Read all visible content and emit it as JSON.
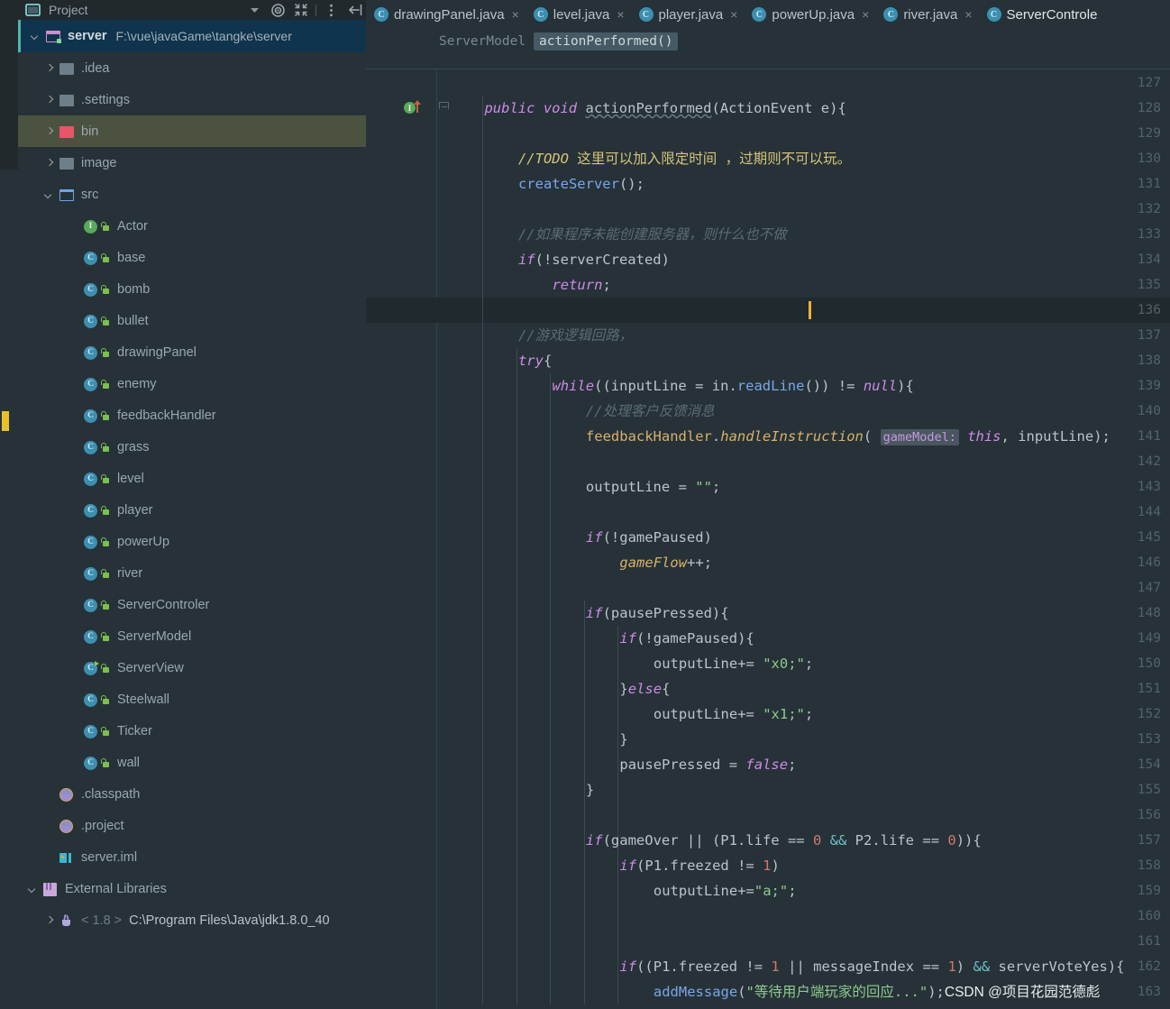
{
  "panel": {
    "title": "Project",
    "icons": {
      "title_icon": "project-folder-icon",
      "dropdown": "chevron-down-icon",
      "locate": "target-locate-icon",
      "collapse_all": "collapse-all-icon",
      "options": "more-vertical-icon",
      "hide": "hide-panel-icon"
    }
  },
  "tree": [
    {
      "label": "server",
      "path": "F:\\vue\\javaGame\\tangke\\server",
      "icon": "module-folder-icon",
      "arrow": "down",
      "depth": 0,
      "state": "root"
    },
    {
      "label": ".idea",
      "path": "",
      "icon": "folder-icon",
      "arrow": "right",
      "depth": 1,
      "state": ""
    },
    {
      "label": ".settings",
      "path": "",
      "icon": "folder-icon",
      "arrow": "right",
      "depth": 1,
      "state": ""
    },
    {
      "label": "bin",
      "path": "",
      "icon": "folder-excluded-icon",
      "arrow": "right",
      "depth": 1,
      "state": "selected"
    },
    {
      "label": "image",
      "path": "",
      "icon": "folder-icon",
      "arrow": "right",
      "depth": 1,
      "state": ""
    },
    {
      "label": "src",
      "path": "",
      "icon": "source-folder-icon",
      "arrow": "down",
      "depth": 1,
      "state": ""
    },
    {
      "label": "Actor",
      "path": "",
      "icon": "interface-icon",
      "arrow": "",
      "depth": 2,
      "state": ""
    },
    {
      "label": "base",
      "path": "",
      "icon": "class-icon",
      "arrow": "",
      "depth": 2,
      "state": ""
    },
    {
      "label": "bomb",
      "path": "",
      "icon": "class-icon",
      "arrow": "",
      "depth": 2,
      "state": ""
    },
    {
      "label": "bullet",
      "path": "",
      "icon": "class-icon",
      "arrow": "",
      "depth": 2,
      "state": ""
    },
    {
      "label": "drawingPanel",
      "path": "",
      "icon": "class-icon",
      "arrow": "",
      "depth": 2,
      "state": ""
    },
    {
      "label": "enemy",
      "path": "",
      "icon": "class-icon",
      "arrow": "",
      "depth": 2,
      "state": ""
    },
    {
      "label": "feedbackHandler",
      "path": "",
      "icon": "class-icon",
      "arrow": "",
      "depth": 2,
      "state": ""
    },
    {
      "label": "grass",
      "path": "",
      "icon": "class-icon",
      "arrow": "",
      "depth": 2,
      "state": ""
    },
    {
      "label": "level",
      "path": "",
      "icon": "class-icon",
      "arrow": "",
      "depth": 2,
      "state": ""
    },
    {
      "label": "player",
      "path": "",
      "icon": "class-icon",
      "arrow": "",
      "depth": 2,
      "state": ""
    },
    {
      "label": "powerUp",
      "path": "",
      "icon": "class-icon",
      "arrow": "",
      "depth": 2,
      "state": ""
    },
    {
      "label": "river",
      "path": "",
      "icon": "class-icon",
      "arrow": "",
      "depth": 2,
      "state": ""
    },
    {
      "label": "ServerControler",
      "path": "",
      "icon": "class-icon",
      "arrow": "",
      "depth": 2,
      "state": ""
    },
    {
      "label": "ServerModel",
      "path": "",
      "icon": "class-icon",
      "arrow": "",
      "depth": 2,
      "state": ""
    },
    {
      "label": "ServerView",
      "path": "",
      "icon": "runnable-class-icon",
      "arrow": "",
      "depth": 2,
      "state": ""
    },
    {
      "label": "Steelwall",
      "path": "",
      "icon": "class-icon",
      "arrow": "",
      "depth": 2,
      "state": ""
    },
    {
      "label": "Ticker",
      "path": "",
      "icon": "class-icon",
      "arrow": "",
      "depth": 2,
      "state": ""
    },
    {
      "label": "wall",
      "path": "",
      "icon": "class-icon",
      "arrow": "",
      "depth": 2,
      "state": ""
    },
    {
      "label": ".classpath",
      "path": "",
      "icon": "xml-file-icon",
      "arrow": "",
      "depth": 1,
      "state": ""
    },
    {
      "label": ".project",
      "path": "",
      "icon": "xml-file-icon",
      "arrow": "",
      "depth": 1,
      "state": ""
    },
    {
      "label": "server.iml",
      "path": "",
      "icon": "iml-file-icon",
      "arrow": "",
      "depth": 1,
      "state": ""
    },
    {
      "label": "External Libraries",
      "path": "",
      "icon": "library-icon",
      "arrow": "down",
      "depth": 0,
      "state": ""
    },
    {
      "label": "< 1.8 >",
      "path": "C:\\Program Files\\Java\\jdk1.8.0_40",
      "icon": "jdk-icon",
      "arrow": "right",
      "depth": 1,
      "state": "jdk"
    }
  ],
  "tabs": [
    {
      "label": "drawingPanel.java",
      "closable": true,
      "active": false
    },
    {
      "label": "level.java",
      "closable": true,
      "active": false
    },
    {
      "label": "player.java",
      "closable": true,
      "active": false
    },
    {
      "label": "powerUp.java",
      "closable": true,
      "active": false
    },
    {
      "label": "river.java",
      "closable": true,
      "active": false
    },
    {
      "label": "ServerControle",
      "closable": false,
      "active": true
    }
  ],
  "tab_close_glyph": "×",
  "breadcrumb": {
    "class": "ServerModel",
    "method": "actionPerformed()"
  },
  "editor": {
    "first_line": 127,
    "last_line": 163,
    "current_line": 136,
    "gutter_glyphs": {
      "line": 128,
      "impl": "I",
      "override_arrow": "override-up-arrow-icon",
      "fold": "fold-region-icon"
    },
    "watermark": "CSDN @项目花园范德彪",
    "lines": [
      {
        "n": 127,
        "code": ""
      },
      {
        "n": 128,
        "code": "    public void actionPerformed(ActionEvent e){"
      },
      {
        "n": 129,
        "code": ""
      },
      {
        "n": 130,
        "code": "        //TODO 这里可以加入限定时间 ，过期则不可以玩。"
      },
      {
        "n": 131,
        "code": "        createServer();"
      },
      {
        "n": 132,
        "code": ""
      },
      {
        "n": 133,
        "code": "        //如果程序未能创建服务器，则什么也不做"
      },
      {
        "n": 134,
        "code": "        if(!serverCreated)"
      },
      {
        "n": 135,
        "code": "            return;"
      },
      {
        "n": 136,
        "code": ""
      },
      {
        "n": 137,
        "code": "        //游戏逻辑回路，"
      },
      {
        "n": 138,
        "code": "        try{"
      },
      {
        "n": 139,
        "code": "            while((inputLine = in.readLine()) != null){"
      },
      {
        "n": 140,
        "code": "                //处理客户反馈消息"
      },
      {
        "n": 141,
        "code": "                feedbackHandler.handleInstruction( gameModel: this, inputLine);"
      },
      {
        "n": 142,
        "code": ""
      },
      {
        "n": 143,
        "code": "                outputLine = \"\";"
      },
      {
        "n": 144,
        "code": ""
      },
      {
        "n": 145,
        "code": "                if(!gamePaused)"
      },
      {
        "n": 146,
        "code": "                    gameFlow++;"
      },
      {
        "n": 147,
        "code": ""
      },
      {
        "n": 148,
        "code": "                if(pausePressed){"
      },
      {
        "n": 149,
        "code": "                    if(!gamePaused){"
      },
      {
        "n": 150,
        "code": "                        outputLine+= \"x0;\";"
      },
      {
        "n": 151,
        "code": "                    }else{"
      },
      {
        "n": 152,
        "code": "                        outputLine+= \"x1;\";"
      },
      {
        "n": 153,
        "code": "                    }"
      },
      {
        "n": 154,
        "code": "                    pausePressed = false;"
      },
      {
        "n": 155,
        "code": "                }"
      },
      {
        "n": 156,
        "code": ""
      },
      {
        "n": 157,
        "code": "                if(gameOver || (P1.life == 0 && P2.life == 0)){"
      },
      {
        "n": 158,
        "code": "                    if(P1.freezed != 1)"
      },
      {
        "n": 159,
        "code": "                        outputLine+=\"a;\";"
      },
      {
        "n": 160,
        "code": ""
      },
      {
        "n": 161,
        "code": ""
      },
      {
        "n": 162,
        "code": "                    if((P1.freezed != 1 || messageIndex == 1) && serverVoteYes){"
      },
      {
        "n": 163,
        "code": "                        addMessage(\"等待用户端玩家的回应...\");"
      }
    ]
  },
  "colors": {
    "background": "#263238",
    "gutter_text": "#53626b",
    "keyword": "#cf8ae8",
    "string": "#8fc98f",
    "number": "#d1776f",
    "comment": "#5b6b74",
    "field": "#d9b06a",
    "method_call": "#7aa6e8",
    "operator": "#6fbfc9",
    "selection_root": "#10344e",
    "selection_excluded": "#4c5240",
    "caret": "#f0b429",
    "accent_teal": "#4db6ac"
  }
}
